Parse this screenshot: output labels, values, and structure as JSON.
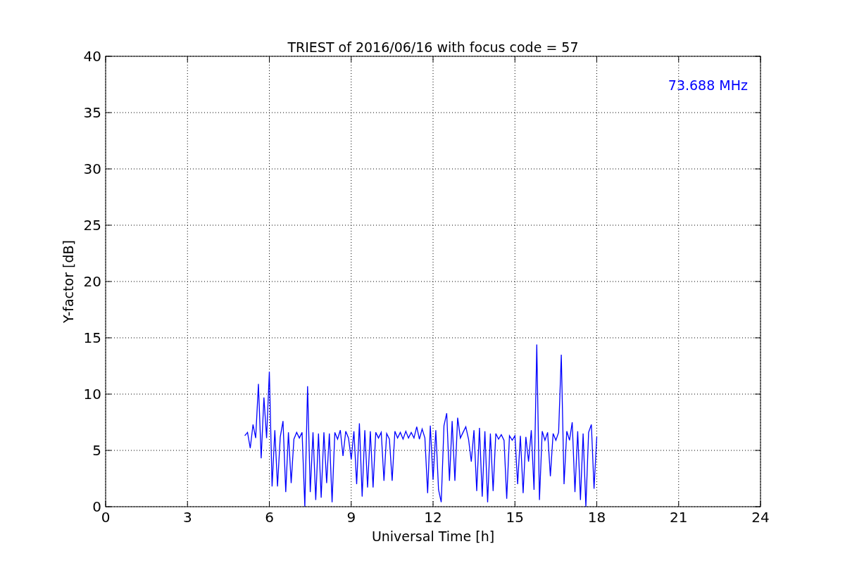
{
  "chart_data": {
    "type": "line",
    "title": "TRIEST of 2016/06/16 with focus code = 57",
    "xlabel": "Universal Time [h]",
    "ylabel": "Y-factor [dB]",
    "xlim": [
      0,
      24
    ],
    "ylim": [
      0,
      40
    ],
    "xticks": [
      0,
      3,
      6,
      9,
      12,
      15,
      18,
      21,
      24
    ],
    "yticks": [
      0,
      5,
      10,
      15,
      20,
      25,
      30,
      35,
      40
    ],
    "x": [
      5.1,
      5.2,
      5.3,
      5.4,
      5.5,
      5.6,
      5.7,
      5.8,
      5.9,
      6.0,
      6.1,
      6.2,
      6.3,
      6.4,
      6.5,
      6.6,
      6.7,
      6.8,
      6.9,
      7.0,
      7.1,
      7.2,
      7.3,
      7.4,
      7.5,
      7.6,
      7.7,
      7.8,
      7.9,
      8.0,
      8.1,
      8.2,
      8.3,
      8.4,
      8.5,
      8.6,
      8.7,
      8.8,
      8.9,
      9.0,
      9.1,
      9.2,
      9.3,
      9.4,
      9.5,
      9.6,
      9.7,
      9.8,
      9.9,
      10.0,
      10.1,
      10.2,
      10.3,
      10.4,
      10.5,
      10.6,
      10.7,
      10.8,
      10.9,
      11.0,
      11.1,
      11.2,
      11.3,
      11.4,
      11.5,
      11.6,
      11.7,
      11.8,
      11.9,
      12.0,
      12.1,
      12.2,
      12.3,
      12.4,
      12.5,
      12.6,
      12.7,
      12.8,
      12.9,
      13.0,
      13.1,
      13.2,
      13.3,
      13.4,
      13.5,
      13.6,
      13.7,
      13.8,
      13.9,
      14.0,
      14.1,
      14.2,
      14.3,
      14.4,
      14.5,
      14.6,
      14.7,
      14.8,
      14.9,
      15.0,
      15.1,
      15.2,
      15.3,
      15.4,
      15.5,
      15.6,
      15.7,
      15.8,
      15.9,
      16.0,
      16.1,
      16.2,
      16.3,
      16.4,
      16.5,
      16.6,
      16.7,
      16.8,
      16.9,
      17.0,
      17.1,
      17.2,
      17.3,
      17.4,
      17.5,
      17.6,
      17.7,
      17.8,
      17.9,
      18.0
    ],
    "series": [
      {
        "name": "73.688 MHz",
        "color": "#0000ff",
        "values": [
          6.3,
          6.6,
          5.2,
          7.3,
          6.1,
          10.9,
          4.3,
          9.7,
          6.1,
          12.0,
          1.8,
          6.8,
          1.8,
          6.2,
          7.6,
          1.3,
          6.6,
          2.1,
          6.0,
          6.6,
          6.1,
          6.6,
          0.0,
          10.7,
          1.3,
          6.6,
          0.6,
          6.5,
          0.8,
          6.6,
          2.1,
          6.5,
          0.4,
          6.6,
          6.0,
          6.8,
          4.5,
          6.7,
          6.1,
          4.2,
          6.7,
          2.0,
          7.4,
          0.9,
          6.8,
          1.7,
          6.7,
          1.7,
          6.6,
          6.1,
          6.6,
          2.3,
          6.5,
          6.0,
          2.3,
          6.7,
          6.1,
          6.6,
          6.0,
          6.7,
          6.1,
          6.6,
          6.1,
          7.1,
          6.0,
          6.9,
          6.1,
          1.2,
          7.2,
          2.4,
          6.8,
          1.5,
          0.4,
          7.2,
          8.3,
          2.3,
          7.6,
          2.3,
          7.9,
          6.1,
          6.6,
          7.1,
          6.0,
          4.0,
          6.8,
          1.4,
          7.0,
          0.9,
          6.7,
          0.4,
          6.5,
          1.4,
          6.5,
          6.0,
          6.4,
          5.9,
          0.7,
          6.3,
          5.9,
          6.3,
          2.0,
          6.3,
          1.2,
          6.2,
          4.0,
          6.8,
          1.5,
          14.4,
          0.6,
          6.7,
          5.9,
          6.6,
          2.7,
          6.5,
          5.9,
          6.6,
          13.5,
          2.0,
          6.7,
          5.9,
          7.5,
          1.3,
          6.7,
          0.6,
          6.5,
          0.0,
          6.6,
          7.3,
          1.6,
          6.2
        ]
      }
    ],
    "grid": true
  }
}
